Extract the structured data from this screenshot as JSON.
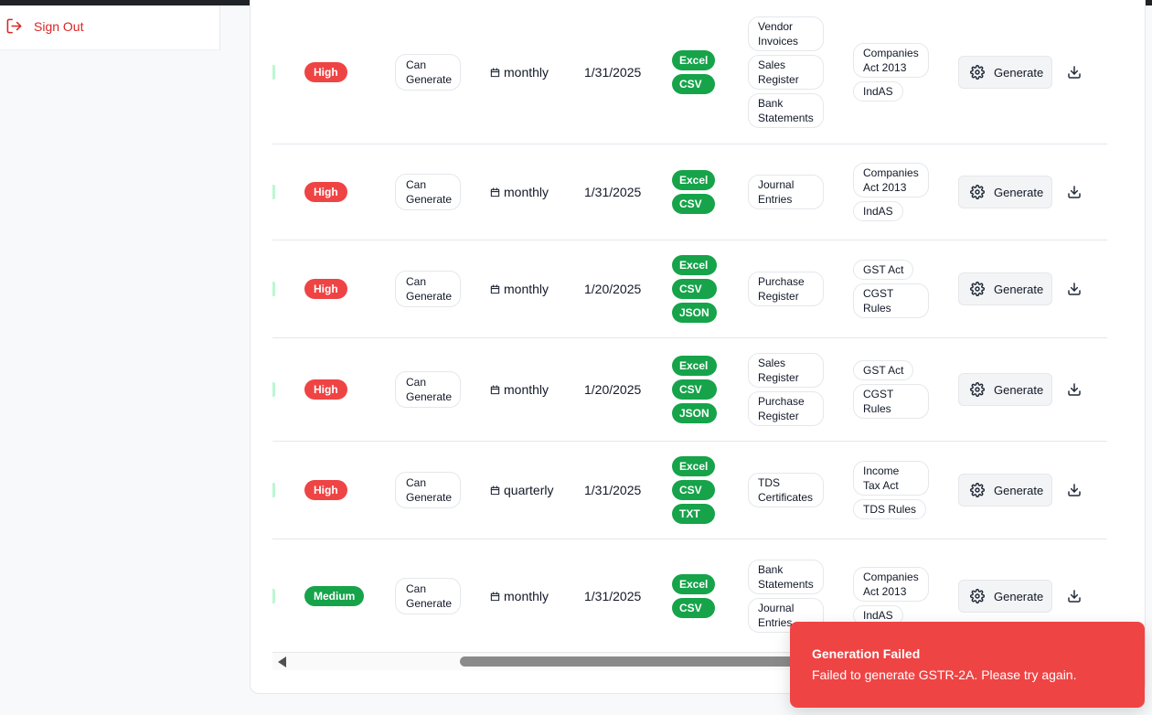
{
  "sidebar": {
    "sign_out_label": "Sign Out"
  },
  "table": {
    "generate_label": "Generate",
    "rows": [
      {
        "priority": "High",
        "priority_level": "high",
        "status": [
          "Can",
          "Generate"
        ],
        "frequency": "monthly",
        "due_date": "1/31/2025",
        "formats": [
          "Excel",
          "CSV"
        ],
        "sources": [
          [
            "Vendor",
            "Invoices"
          ],
          [
            "Sales",
            "Register"
          ],
          [
            "Bank",
            "Statements"
          ]
        ],
        "laws": [
          [
            "Companies",
            "Act 2013"
          ],
          [
            "IndAS"
          ]
        ]
      },
      {
        "priority": "High",
        "priority_level": "high",
        "status": [
          "Can",
          "Generate"
        ],
        "frequency": "monthly",
        "due_date": "1/31/2025",
        "formats": [
          "Excel",
          "CSV"
        ],
        "sources": [
          [
            "Journal",
            "Entries"
          ]
        ],
        "laws": [
          [
            "Companies",
            "Act 2013"
          ],
          [
            "IndAS"
          ]
        ]
      },
      {
        "priority": "High",
        "priority_level": "high",
        "status": [
          "Can",
          "Generate"
        ],
        "frequency": "monthly",
        "due_date": "1/20/2025",
        "formats": [
          "Excel",
          "CSV",
          "JSON"
        ],
        "sources": [
          [
            "Purchase",
            "Register"
          ]
        ],
        "laws": [
          [
            "GST Act"
          ],
          [
            "CGST",
            "Rules"
          ]
        ]
      },
      {
        "priority": "High",
        "priority_level": "high",
        "status": [
          "Can",
          "Generate"
        ],
        "frequency": "monthly",
        "due_date": "1/20/2025",
        "formats": [
          "Excel",
          "CSV",
          "JSON"
        ],
        "sources": [
          [
            "Sales",
            "Register"
          ],
          [
            "Purchase",
            "Register"
          ]
        ],
        "laws": [
          [
            "GST Act"
          ],
          [
            "CGST",
            "Rules"
          ]
        ]
      },
      {
        "priority": "High",
        "priority_level": "high",
        "status": [
          "Can",
          "Generate"
        ],
        "frequency": "quarterly",
        "due_date": "1/31/2025",
        "formats": [
          "Excel",
          "CSV",
          "TXT"
        ],
        "sources": [
          [
            "TDS",
            "Certificates"
          ]
        ],
        "laws": [
          [
            "Income",
            "Tax Act"
          ],
          [
            "TDS Rules"
          ]
        ]
      },
      {
        "priority": "Medium",
        "priority_level": "medium",
        "status": [
          "Can",
          "Generate"
        ],
        "frequency": "monthly",
        "due_date": "1/31/2025",
        "formats": [
          "Excel",
          "CSV"
        ],
        "sources": [
          [
            "Bank",
            "Statements"
          ],
          [
            "Journal",
            "Entries"
          ]
        ],
        "laws": [
          [
            "Companies",
            "Act 2013"
          ],
          [
            "IndAS"
          ]
        ]
      }
    ]
  },
  "toast": {
    "title": "Generation Failed",
    "description": "Failed to generate GSTR-2A. Please try again.",
    "color": "#ef4444"
  },
  "colors": {
    "high": "#ef4444",
    "medium": "#16a34a",
    "format_badge": "#16a34a",
    "danger_text": "#dc2626"
  },
  "icons": {
    "sign_out": "log-out-icon",
    "frequency": "calendar-icon",
    "generate": "gear-icon",
    "download": "download-icon"
  }
}
